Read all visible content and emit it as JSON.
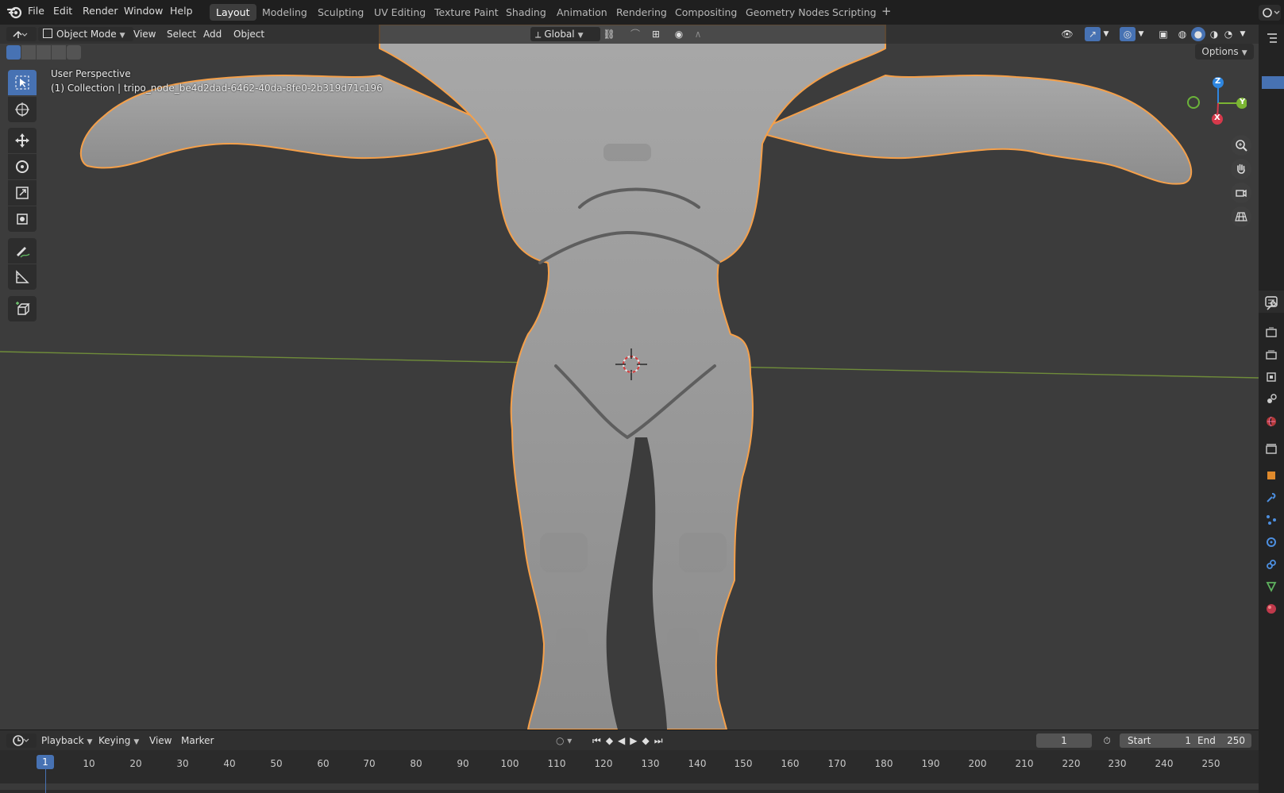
{
  "menubar": {
    "items": [
      "File",
      "Edit",
      "Render",
      "Window",
      "Help"
    ],
    "workspaces": [
      "Layout",
      "Modeling",
      "Sculpting",
      "UV Editing",
      "Texture Paint",
      "Shading",
      "Animation",
      "Rendering",
      "Compositing",
      "Geometry Nodes",
      "Scripting"
    ],
    "add_tab": "+"
  },
  "viewport": {
    "mode": "Object Mode",
    "menus": [
      "View",
      "Select",
      "Add",
      "Object"
    ],
    "orientation": "Global",
    "options_label": "Options",
    "info_line1": "User Perspective",
    "info_line2": "(1) Collection | tripo_node_be4d2dad-6462-40da-8fe0-2b319d71c196"
  },
  "gizmo": {
    "z": "Z",
    "y": "Y",
    "x": "X"
  },
  "timeline": {
    "menus": [
      "Playback",
      "Keying",
      "View",
      "Marker"
    ],
    "current_frame": "1",
    "start_label": "Start",
    "start_value": "1",
    "end_label": "End",
    "end_value": "250",
    "ruler": [
      "1",
      "10",
      "20",
      "30",
      "40",
      "50",
      "60",
      "70",
      "80",
      "90",
      "100",
      "110",
      "120",
      "130",
      "140",
      "150",
      "160",
      "170",
      "180",
      "190",
      "200",
      "210",
      "220",
      "230",
      "240",
      "250"
    ]
  },
  "colors": {
    "accent": "#4772b3",
    "selection_outline": "#f5a04a",
    "x_axis": "#d6394b",
    "y_axis": "#7bb533",
    "z_axis": "#2e86e0"
  }
}
